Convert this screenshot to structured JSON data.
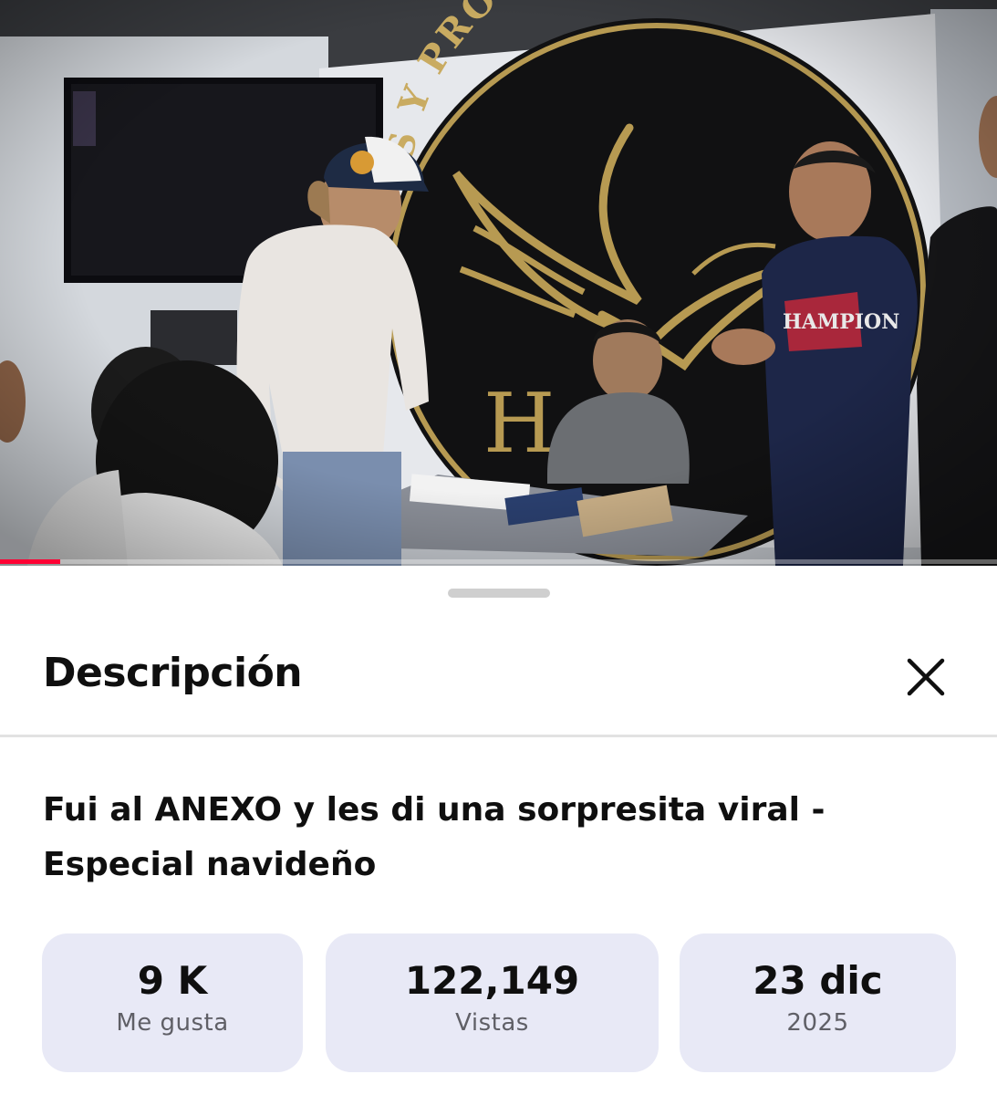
{
  "video": {
    "thumbnail_icon": "video-frame-illustration",
    "banner_text": "AS Y PROMESAS DEL M",
    "shirt_text": "HAMPION",
    "progress_fraction": 0.06,
    "progress_color": "#ff0033"
  },
  "sheet": {
    "title": "Descripción",
    "close_icon": "close-icon"
  },
  "description": {
    "video_title": "Fui al ANEXO y les di una sorpresita viral - Especial navideño"
  },
  "stats": [
    {
      "value": "9 K",
      "label": "Me gusta"
    },
    {
      "value": "122,149",
      "label": "Vistas"
    },
    {
      "value": "23 dic",
      "label": "2025"
    }
  ],
  "colors": {
    "stat_background": "#e8e9f6",
    "accent": "#ff0033"
  }
}
